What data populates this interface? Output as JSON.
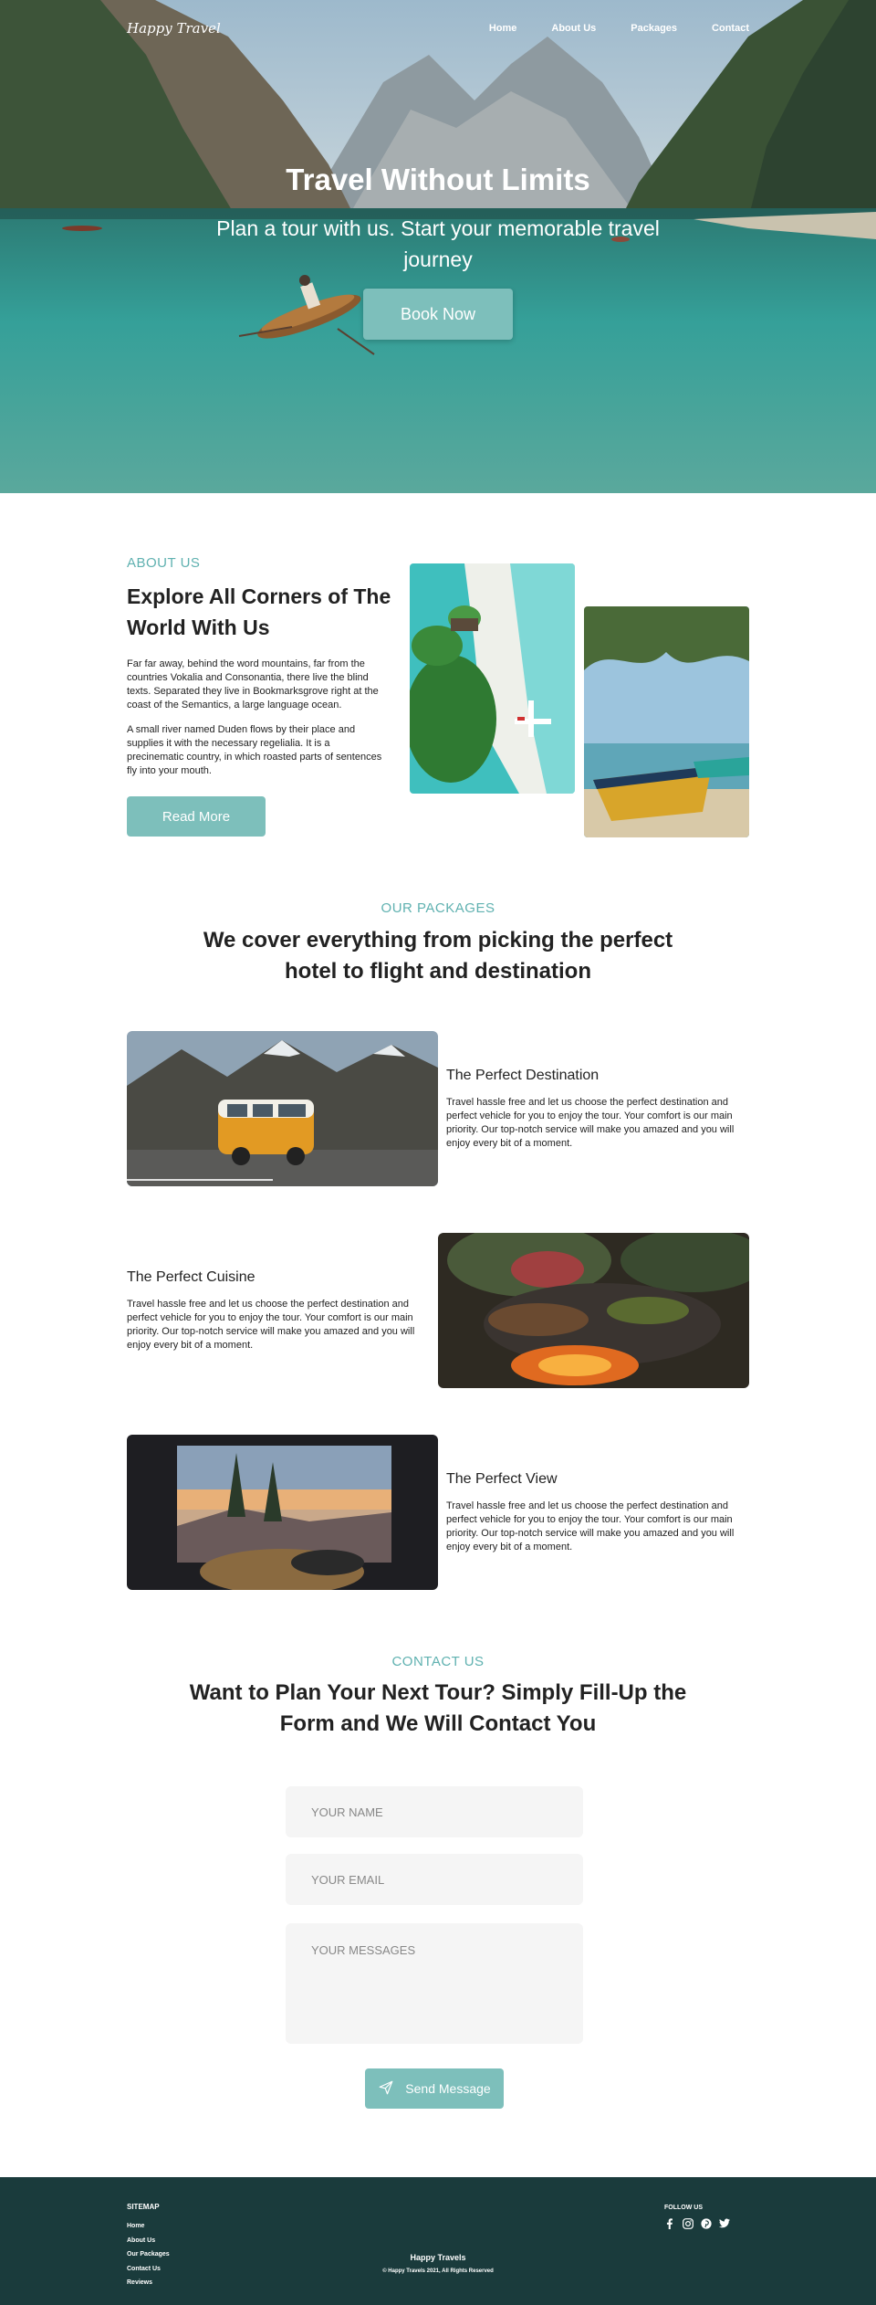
{
  "header": {
    "logo": "Happy Travel",
    "nav": [
      "Home",
      "About Us",
      "Packages",
      "Contact"
    ]
  },
  "hero": {
    "title": "Travel Without Limits",
    "subtitle": "Plan a tour with us. Start your memorable travel journey",
    "button": "Book Now"
  },
  "about": {
    "eyebrow": "ABOUT US",
    "title": "Explore All Corners of The World With Us",
    "paragraph1": "Far far away, behind the word mountains, far from the countries Vokalia and Consonantia, there live the blind texts. Separated they live in Bookmarksgrove right at the coast of the Semantics, a large language ocean.",
    "paragraph2": "A small river named Duden flows by their place and supplies it with the necessary regelialia. It is a precinematic country, in which roasted parts of sentences fly into your mouth.",
    "button": "Read More"
  },
  "packages": {
    "eyebrow": "OUR PACKAGES",
    "title": "We cover everything from picking the perfect hotel to flight and destination",
    "items": [
      {
        "name": "The Perfect Destination",
        "description": "Travel hassle free and let us choose the perfect destination and perfect vehicle for you to enjoy the tour. Your comfort is our main priority. Our top-notch service will make you amazed and you will enjoy every bit of a moment."
      },
      {
        "name": "The Perfect Cuisine",
        "description": "Travel hassle free and let us choose the perfect destination and perfect vehicle for you to enjoy the tour. Your comfort is our main priority. Our top-notch service will make you amazed and you will enjoy every bit of a moment."
      },
      {
        "name": "The Perfect View",
        "description": "Travel hassle free and let us choose the perfect destination and perfect vehicle for you to enjoy the tour. Your comfort is our main priority. Our top-notch service will make you amazed and you will enjoy every bit of a moment."
      }
    ]
  },
  "contact": {
    "eyebrow": "CONTACT US",
    "title": "Want to Plan Your Next Tour? Simply Fill-Up the Form and We Will Contact You",
    "name_placeholder": "YOUR NAME",
    "email_placeholder": "YOUR EMAIL",
    "message_placeholder": "YOUR MESSAGES",
    "button": "Send Message"
  },
  "footer": {
    "sitemap_title": "SITEMAP",
    "sitemap_links": [
      "Home",
      "About Us",
      "Our Packages",
      "Contact Us",
      "Reviews"
    ],
    "brand": "Happy Travels",
    "copyright": "© Happy Travels 2021, All Rights Reserved",
    "follow_title": "FOLLOW US",
    "social_icons": [
      "facebook-icon",
      "instagram-icon",
      "pinterest-icon",
      "twitter-icon"
    ]
  },
  "colors": {
    "accent": "#7dbfbb",
    "eyebrow": "#5fb1b0",
    "footer_bg": "#1a3b3c",
    "field_bg": "#f5f5f5"
  }
}
